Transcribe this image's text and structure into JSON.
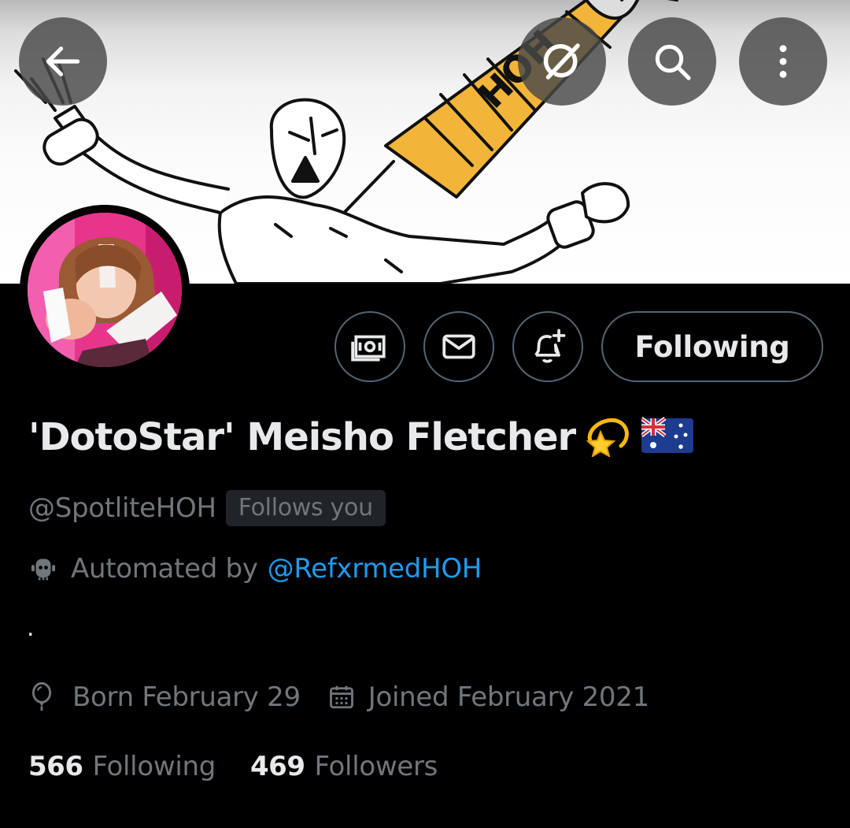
{
  "profile": {
    "display_name": "'DotoStar' Meisho Fletcher",
    "handle": "@SpotliteHOH",
    "follows_you_badge": "Follows you",
    "automated_prefix": "Automated by",
    "automated_by": "@RefxrmedHOH",
    "bio": ".",
    "birthday": "Born February 29",
    "joined": "Joined February 2021",
    "following_count": "566",
    "following_label": "Following",
    "followers_count": "469",
    "followers_label": "Followers"
  },
  "actions": {
    "follow_button_label": "Following"
  },
  "banner": {
    "syringe_label": "HOH"
  },
  "icons": {
    "back": "arrow-left-icon",
    "grok": "grok-icon",
    "search": "search-icon",
    "more": "more-vertical-icon",
    "tip": "money-icon",
    "message": "envelope-icon",
    "notify": "bell-plus-icon",
    "automated": "robot-icon",
    "birthday": "balloon-icon",
    "joined": "calendar-icon"
  },
  "colors": {
    "background": "#000000",
    "primary_text": "#e7e9ea",
    "secondary_text": "#71767b",
    "link": "#1d9bf0",
    "border": "#536471"
  }
}
